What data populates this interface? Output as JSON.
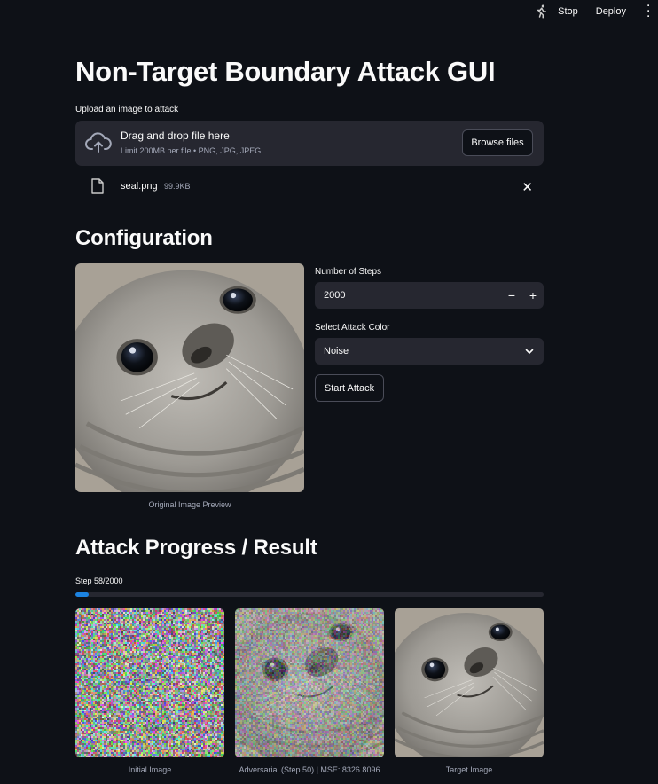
{
  "topbar": {
    "stop_label": "Stop",
    "deploy_label": "Deploy",
    "running_icon": "running-man-icon",
    "menu_icon": "kebab-menu-icon"
  },
  "page": {
    "title": "Non-Target Boundary Attack GUI"
  },
  "uploader": {
    "label": "Upload an image to attack",
    "drop_text": "Drag and drop file here",
    "limit_text": "Limit 200MB per file • PNG, JPG, JPEG",
    "browse_label": "Browse files",
    "file": {
      "name": "seal.png",
      "size": "99.9KB"
    }
  },
  "config": {
    "heading": "Configuration",
    "preview_caption": "Original Image Preview",
    "steps_label": "Number of Steps",
    "steps_value": "2000",
    "minus_label": "−",
    "plus_label": "+",
    "color_label": "Select Attack Color",
    "color_value": "Noise",
    "start_label": "Start Attack"
  },
  "progress": {
    "heading": "Attack Progress / Result",
    "step_text": "Step 58/2000",
    "fraction": 0.029,
    "accent_color": "#1c83e1",
    "captions": {
      "initial": "Initial Image",
      "adversarial": "Adversarial (Step 50) | MSE: 8326.8096",
      "target": "Target Image"
    }
  },
  "colors": {
    "background": "#0e1117",
    "widget": "#262730",
    "muted_text": "#a3a8b8"
  }
}
